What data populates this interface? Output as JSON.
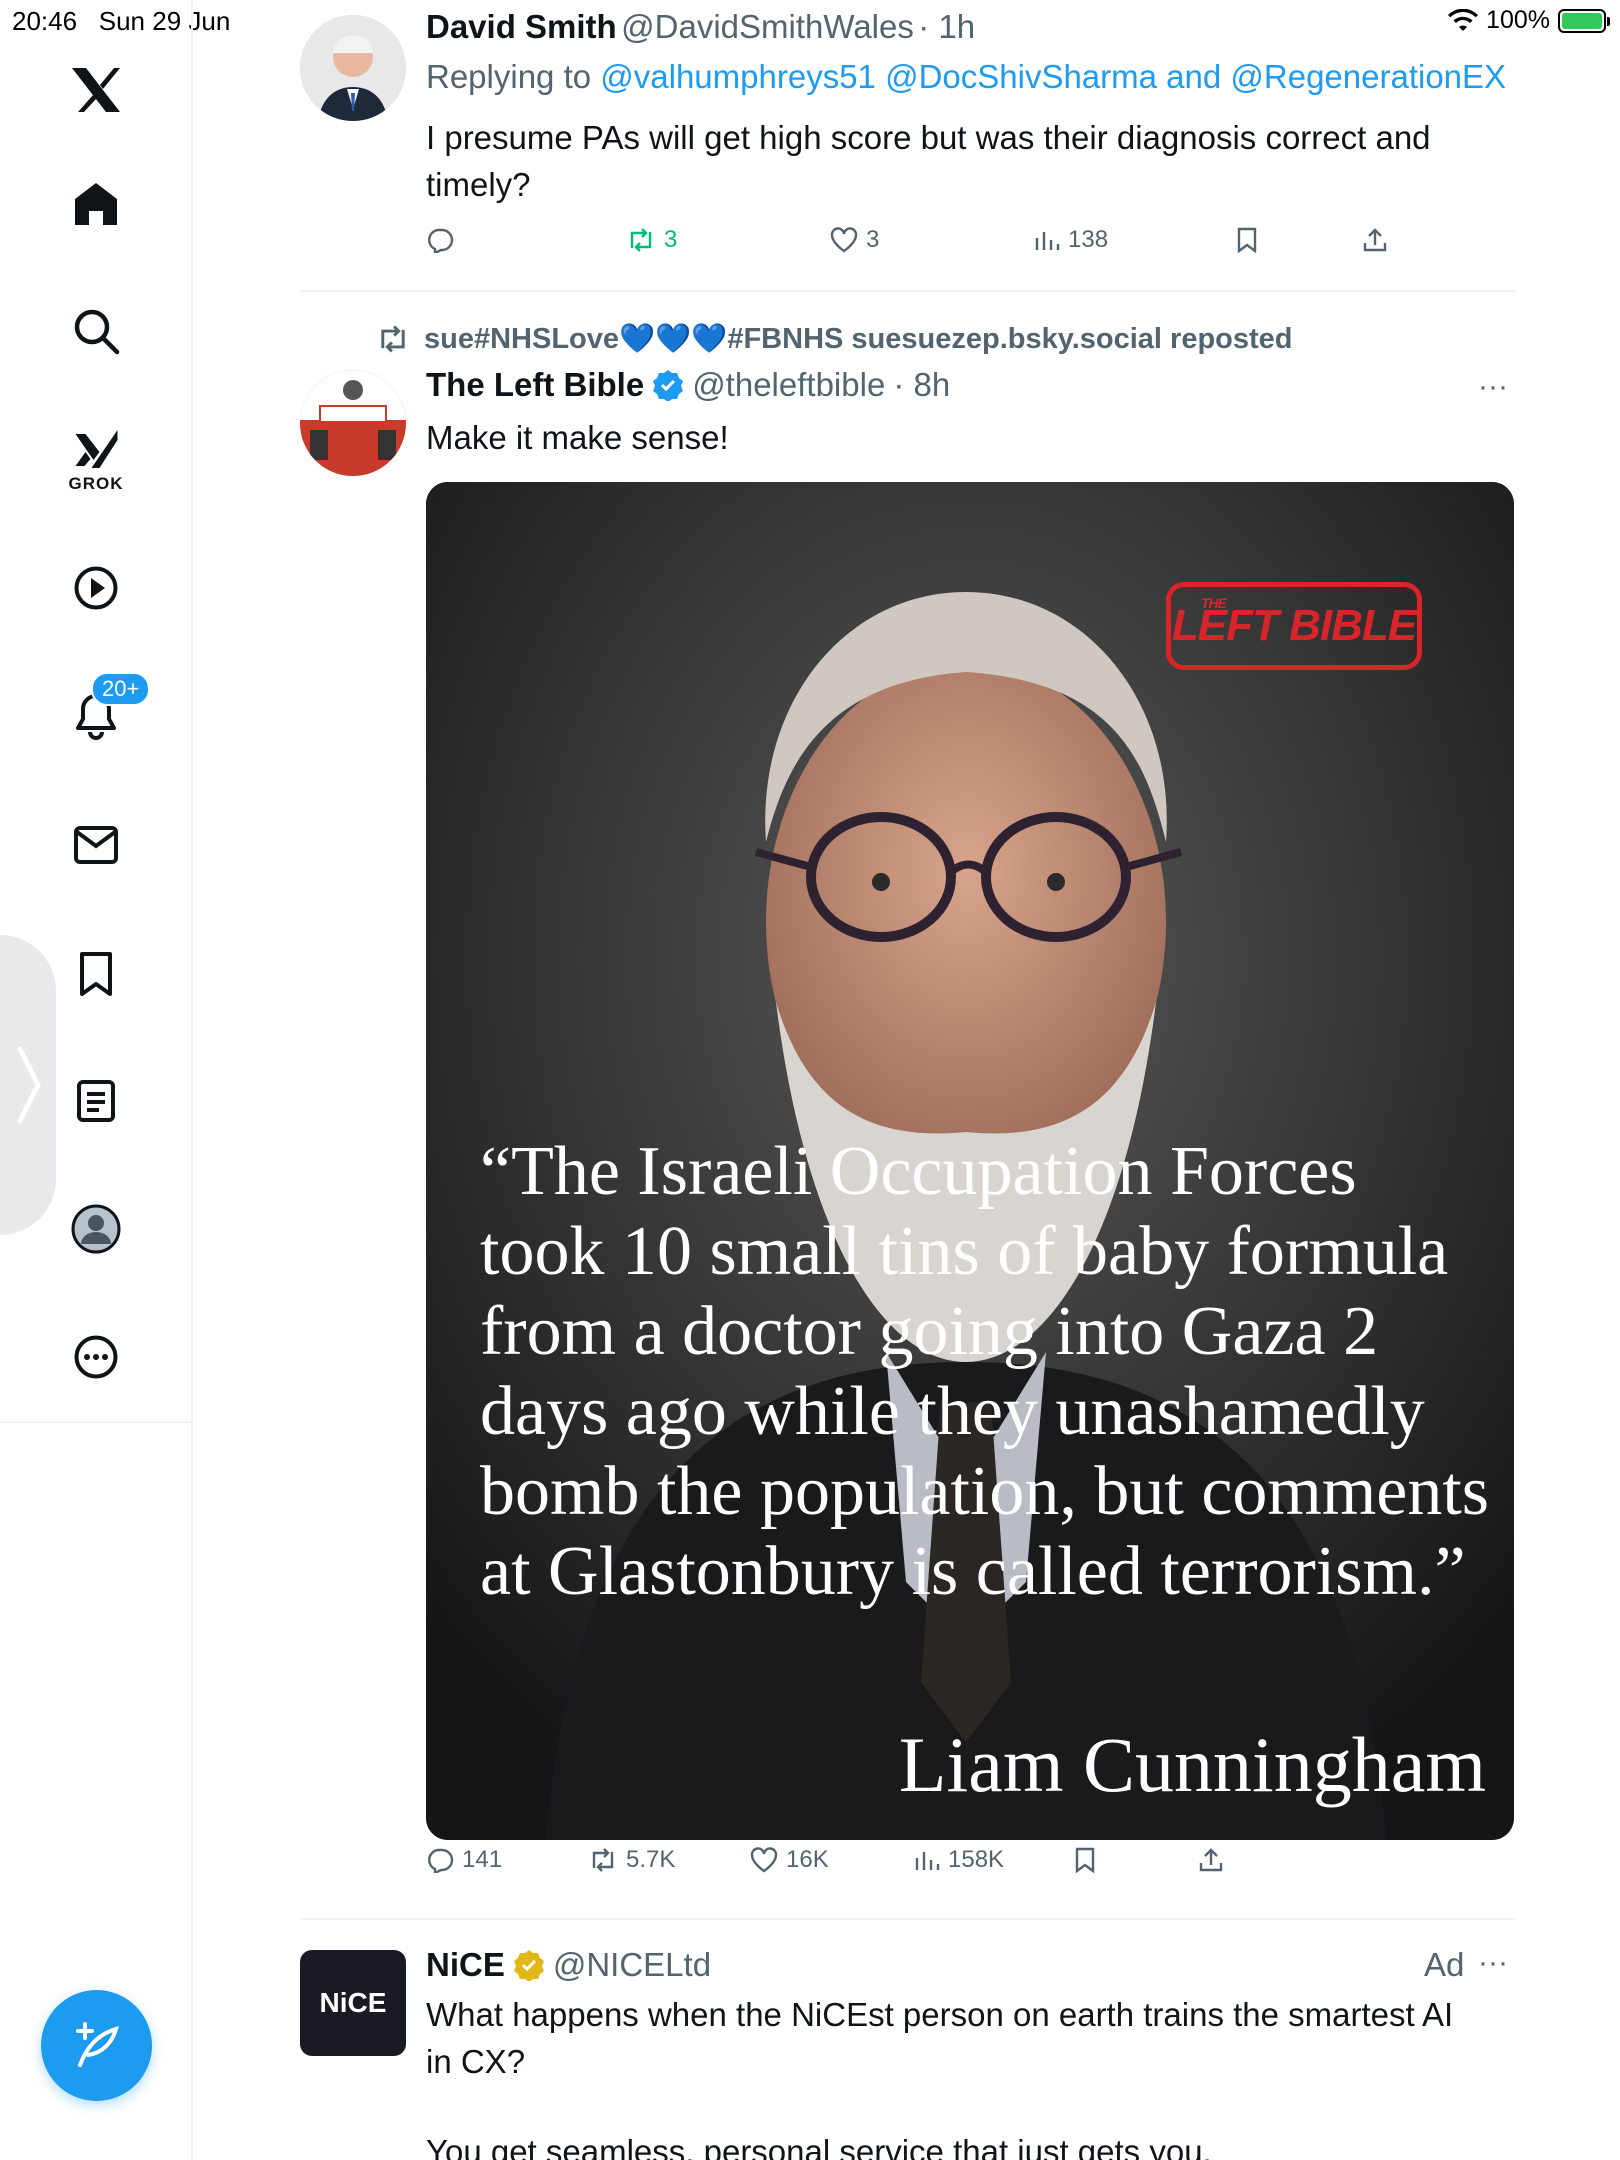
{
  "status_bar": {
    "time": "20:46",
    "date": "Sun 29 Jun",
    "battery": "100%"
  },
  "sidebar": {
    "logo": "x-logo-icon",
    "items": [
      {
        "name": "home",
        "icon": "home-icon"
      },
      {
        "name": "explore",
        "icon": "search-icon"
      },
      {
        "name": "grok",
        "icon": "grok-icon",
        "label": "GROK"
      },
      {
        "name": "video",
        "icon": "play-icon"
      },
      {
        "name": "notifications",
        "icon": "bell-icon",
        "badge": "20+"
      },
      {
        "name": "messages",
        "icon": "mail-icon"
      },
      {
        "name": "bookmarks",
        "icon": "bookmark-icon"
      },
      {
        "name": "lists",
        "icon": "list-icon"
      },
      {
        "name": "profile",
        "icon": "profile-icon"
      },
      {
        "name": "more",
        "icon": "more-icon"
      }
    ]
  },
  "tweets": [
    {
      "name": "David Smith",
      "handle": "@DavidSmithWales",
      "time": "· 1h",
      "replying_prefix": "Replying to ",
      "replying_to": "@valhumphreys51 @DocShivSharma and @RegenerationEX",
      "text_line1": "I presume PAs will get high score but was their diagnosis correct and",
      "text_line2": "timely?",
      "stats": {
        "replies": "",
        "reposts": "3",
        "likes": "3",
        "views": "138"
      }
    },
    {
      "reposted_by": "sue#NHSLove💙💙💙#FBNHS suesuezep.bsky.social reposted",
      "name": "The Left Bible",
      "handle": "@theleftbible",
      "time": "· 8h",
      "text": "Make it make sense!",
      "image": {
        "logo_small": "THE",
        "logo": "LEFT BIBLE",
        "quote": "“The Israeli Occupation Forces took 10 small tins of baby formula from a doctor going into Gaza 2 days ago while they unashamedly bomb the population, but comments at Glastonbury is called terrorism.”",
        "author": "Liam Cunningham"
      },
      "stats": {
        "replies": "141",
        "reposts": "5.7K",
        "likes": "16K",
        "views": "158K"
      }
    },
    {
      "name": "NiCE",
      "handle": "@NICELtd",
      "ad_label": "Ad",
      "logo_text": "NiCE",
      "text_line1": "What happens when the NiCEst person on earth trains the smartest AI",
      "text_line2": "in CX?",
      "text_line3": "You get seamless, personal service that just gets you."
    }
  ],
  "colors": {
    "accent": "#1d9bf0",
    "repost_green": "#00ba7c",
    "muted": "#536471",
    "logo_red": "#d9252a",
    "verified_gold": "#e2b719"
  }
}
